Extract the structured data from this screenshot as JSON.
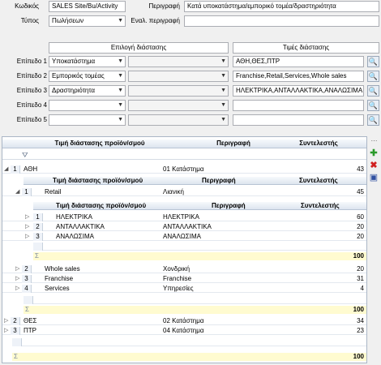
{
  "form": {
    "code_label": "Κωδικός",
    "code_value": "SALES Site/Bu/Activity",
    "type_label": "Τύπος",
    "type_value": "Πωλήσεων",
    "desc_label": "Περιγραφή",
    "desc_value": "Κατά υποκατάστημα/εμπορικό τομέα/δραστηριότητα",
    "alt_desc_label": "Εναλ. περιγραφή",
    "alt_desc_value": "",
    "dim_select_title": "Επιλογή διάστασης",
    "dim_values_title": "Τιμές διάστασης",
    "levels": [
      {
        "label": "Επίπεδο 1",
        "dim": "Υποκατάστημα",
        "values": "ΑΘΗ,ΘΕΣ,ΠΤΡ"
      },
      {
        "label": "Επίπεδο 2",
        "dim": "Εμπορικός τομέας",
        "values": "Franchise,Retail,Services,Whole sales"
      },
      {
        "label": "Επίπεδο 3",
        "dim": "Δραστηριότητα",
        "values": "ΗΛΕΚΤΡΙΚΑ,ΑΝΤΑΛΛΑΚΤΙΚΑ,ΑΝΑΛΩΣΙΜΑ"
      },
      {
        "label": "Επίπεδο 4",
        "dim": "",
        "values": ""
      },
      {
        "label": "Επίπεδο 5",
        "dim": "",
        "values": ""
      }
    ]
  },
  "grid": {
    "col_value": "Τιμή διάστασης προϊόν/σμού",
    "col_desc": "Περιγραφή",
    "col_coef": "Συντελεστής",
    "l1_rows": [
      {
        "n": "1",
        "value": "ΑΘΗ",
        "desc": "01 Κατάστημα",
        "coef": "43"
      },
      {
        "n": "2",
        "value": "ΘΕΣ",
        "desc": "02 Κατάστημα",
        "coef": "34"
      },
      {
        "n": "3",
        "value": "ΠΤΡ",
        "desc": "04 Κατάστημα",
        "coef": "23"
      }
    ],
    "l2_rows": [
      {
        "n": "1",
        "value": "Retail",
        "desc": "Λιανική",
        "coef": "45"
      },
      {
        "n": "2",
        "value": "Whole sales",
        "desc": "Χονδρική",
        "coef": "20"
      },
      {
        "n": "3",
        "value": "Franchise",
        "desc": "Franchise",
        "coef": "31"
      },
      {
        "n": "4",
        "value": "Services",
        "desc": "Υπηρεσίες",
        "coef": "4"
      }
    ],
    "l3_rows": [
      {
        "n": "1",
        "value": "ΗΛΕΚΤΡΙΚΑ",
        "desc": "ΗΛΕΚΤΡΙΚΑ",
        "coef": "60"
      },
      {
        "n": "2",
        "value": "ΑΝΤΑΛΛΑΚΤΙΚΑ",
        "desc": "ΑΝΤΑΛΛΑΚΤΙΚΑ",
        "coef": "20"
      },
      {
        "n": "3",
        "value": "ΑΝΑΛΩΣΙΜΑ",
        "desc": "ΑΝΑΛΩΣΙΜΑ",
        "coef": "20"
      }
    ],
    "sum3": "100",
    "sum2": "100",
    "sum1": "100",
    "sigma": "Σ"
  },
  "icons": {
    "search": "search-icon",
    "add": "add-icon",
    "delete": "delete-icon",
    "save": "save-icon",
    "filter": "filter-icon"
  }
}
